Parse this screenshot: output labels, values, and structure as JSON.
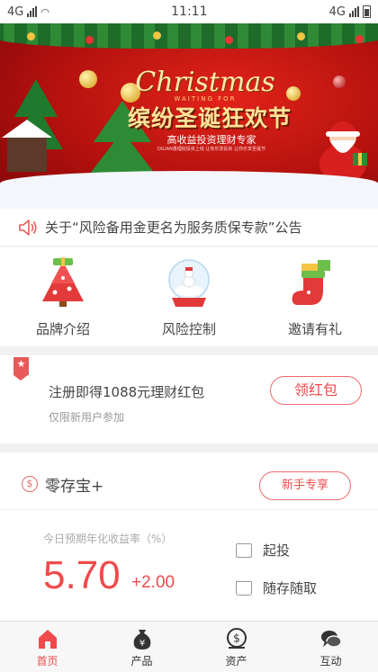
{
  "status_bar": {
    "network_left": "4G",
    "time": "11:11",
    "network_right": "4G"
  },
  "banner": {
    "script_title": "Christmas",
    "small_caps": "WAITING FOR",
    "headline": "缤纷圣诞狂欢节",
    "tagline": "高收益投资理财专家",
    "fine_print": "DILIAN惠理财投资上线 让你乐享投资 让你乐享圣诞节"
  },
  "notice": {
    "text": "关于“风险备用金更名为服务质保专款”公告"
  },
  "features": [
    {
      "label": "品牌介绍",
      "icon": "christmas-tree-icon"
    },
    {
      "label": "风险控制",
      "icon": "snow-globe-icon"
    },
    {
      "label": "邀请有礼",
      "icon": "christmas-stocking-icon"
    }
  ],
  "register": {
    "badge": "★",
    "title": "注册即得1088元理财红包",
    "subtitle": "仅限新用户参加",
    "button": "领红包"
  },
  "product": {
    "icon_glyph": "$",
    "name": "零存宝+",
    "tag_button": "新手专享",
    "rate_label": "今日预期年化收益率（%）",
    "rate": "5.70",
    "bonus": "+2.00",
    "features": [
      "起投",
      "随存随取"
    ]
  },
  "tabs": [
    {
      "label": "首页",
      "icon": "home-icon",
      "active": true
    },
    {
      "label": "产品",
      "icon": "money-bag-icon",
      "active": false
    },
    {
      "label": "资产",
      "icon": "asset-dollar-icon",
      "active": false
    },
    {
      "label": "互动",
      "icon": "chat-bubbles-icon",
      "active": false
    }
  ],
  "colors": {
    "accent": "#f04a4a",
    "banner_red": "#c8150f",
    "background": "#f2f2f2"
  }
}
